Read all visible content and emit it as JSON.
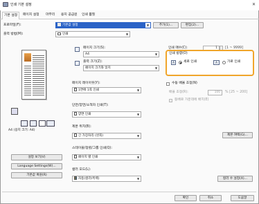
{
  "window": {
    "title": "인쇄 기본 설정",
    "close_glyph": "✕"
  },
  "tabs": [
    "기본 설정",
    "페이지 설정",
    "마무리",
    "용지 공급원",
    "인쇄 품질"
  ],
  "profile": {
    "label": "프로파일(F):",
    "value": "기본값 설정",
    "add_button": "추가(1)...",
    "edit_button": "편집(2)..."
  },
  "output_method": {
    "label": "출력 방법(M):",
    "value": "인쇄"
  },
  "page_size": {
    "label": "페이지 크기(S):",
    "value": "A4"
  },
  "output_size": {
    "label": "출력 크기(Z):",
    "value": "페이지 크기와 일치"
  },
  "copies": {
    "label": "인쇄 매수(C):",
    "value": "1",
    "range": "[1 ~ 9999]"
  },
  "orientation": {
    "label": "인쇄 방향(O)",
    "portrait": "세로 인쇄",
    "landscape": "가로 인쇄",
    "selected": "portrait"
  },
  "layout": {
    "label": "페이지 레이아웃(Y):",
    "value": "1면에 1쪽 인쇄"
  },
  "manual_scale": {
    "label": "수동 배율 조정(N)",
    "scale_label": "배율 조정(R):",
    "scale_value": "100",
    "scale_range": "% [25 ~ 200]",
    "even_label": "등배로 가운데에 배치(E)"
  },
  "duplex": {
    "label": "단면/양면/소책자 인쇄(T):",
    "value": "양면 인쇄"
  },
  "binding": {
    "label": "제본 위치(B):",
    "value": "긴 가장자리 (왼쪽)",
    "margin_button": "제본 여백(G)..."
  },
  "staple": {
    "label": "스테이플/정렬/그룹 인쇄(Q):",
    "value": "페이지 별 인쇄"
  },
  "color_mode": {
    "label": "컬러 모드(L):",
    "value": "자동(컬러/흑백)",
    "color_button": "컬러 수 설정(X)..."
  },
  "preview": {
    "caption": "A4 (용지 크기: A4)"
  },
  "left_buttons": [
    "설정 보기(V)",
    "Language Settings(W)...",
    "기본값 복원(R)"
  ],
  "footer_buttons": [
    "확인",
    "취소",
    "도움말"
  ]
}
